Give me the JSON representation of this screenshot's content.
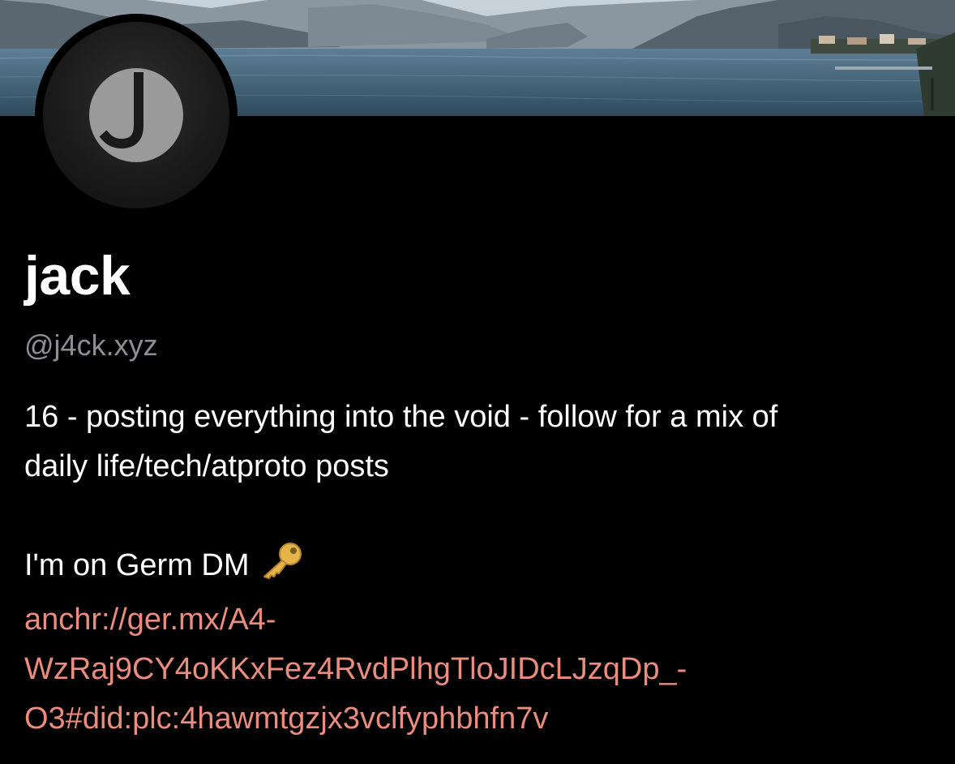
{
  "profile": {
    "display_name": "jack",
    "handle": "@j4ck.xyz",
    "avatar_letter": "J",
    "bio": {
      "line1": "16 - posting everything into the void - follow for a mix of",
      "line2": "daily life/tech/atproto posts",
      "line3": "I'm on Germ DM",
      "link_line1": "anchr://ger.mx/A4-",
      "link_line2": "WzRaj9CY4oKKxFez4RvdPlhgTloJIDcLJzqDp_-",
      "link_line3": "O3#did:plc:4hawmtgzjx3vclfyphbhfn7v"
    }
  },
  "icons": {
    "bio_emoji": "key-icon"
  },
  "colors": {
    "background": "#000000",
    "link": "#ea8c7e",
    "handle": "#8e8e93"
  }
}
